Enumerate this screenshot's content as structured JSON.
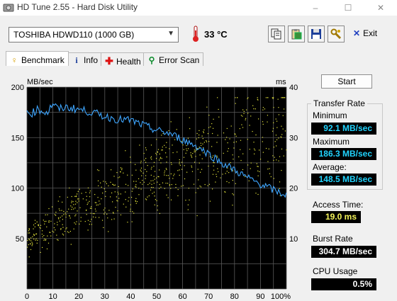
{
  "window": {
    "title": "HD Tune 2.55 - Hard Disk Utility",
    "minimize": "–",
    "maximize": "☐",
    "close": "✕"
  },
  "toolbar": {
    "drive": "TOSHIBA HDWD110 (1000 GB)",
    "temperature": "33 °C",
    "exit_label": "Exit"
  },
  "tabs": [
    {
      "label": "Benchmark"
    },
    {
      "label": "Info"
    },
    {
      "label": "Health"
    },
    {
      "label": "Error Scan"
    }
  ],
  "chart_data": {
    "type": "line",
    "left_axis_label": "MB/sec",
    "right_axis_label": "ms",
    "y_ticks_left": [
      "200",
      "150",
      "100",
      "50"
    ],
    "y_ticks_right": [
      "40",
      "30",
      "20",
      "10"
    ],
    "x_ticks": [
      "0",
      "10",
      "20",
      "30",
      "40",
      "50",
      "60",
      "70",
      "80",
      "90",
      "100%"
    ],
    "ylim_left": [
      0,
      200
    ],
    "ylim_right": [
      0,
      40
    ],
    "xlim": [
      0,
      100
    ],
    "grid": true,
    "series": [
      {
        "color": "#3ea6ff",
        "x": [
          0,
          2,
          4,
          6,
          8,
          10,
          12,
          15,
          20,
          25,
          30,
          35,
          40,
          45,
          50,
          55,
          60,
          65,
          70,
          75,
          80,
          85,
          90,
          95,
          100
        ],
        "y": [
          176,
          174,
          178,
          176,
          175,
          184,
          178,
          180,
          178,
          175,
          171,
          168,
          167,
          162,
          157,
          154,
          148,
          142,
          134,
          125,
          118,
          110,
          104,
          98,
          93
        ]
      }
    ],
    "access_scatter_color": "#e8e83c",
    "access_trend_ms": [
      [
        0,
        10
      ],
      [
        20,
        16
      ],
      [
        40,
        21
      ],
      [
        60,
        25
      ],
      [
        80,
        29
      ],
      [
        100,
        33
      ]
    ]
  },
  "start_label": "Start",
  "transfer_rate": {
    "title": "Transfer Rate",
    "minimum_label": "Minimum",
    "minimum_value": "92.1 MB/sec",
    "maximum_label": "Maximum",
    "maximum_value": "186.3 MB/sec",
    "average_label": "Average:",
    "average_value": "148.5 MB/sec"
  },
  "access_time": {
    "label": "Access Time:",
    "value": "19.0 ms"
  },
  "burst_rate": {
    "label": "Burst Rate",
    "value": "304.7 MB/sec"
  },
  "cpu_usage": {
    "label": "CPU Usage",
    "value": "0.5%"
  },
  "colors": {
    "plot_bg": "#000000",
    "grid": "#5a5a5a",
    "transfer_line": "#3ea6ff",
    "access_dots": "#e8e83c"
  }
}
